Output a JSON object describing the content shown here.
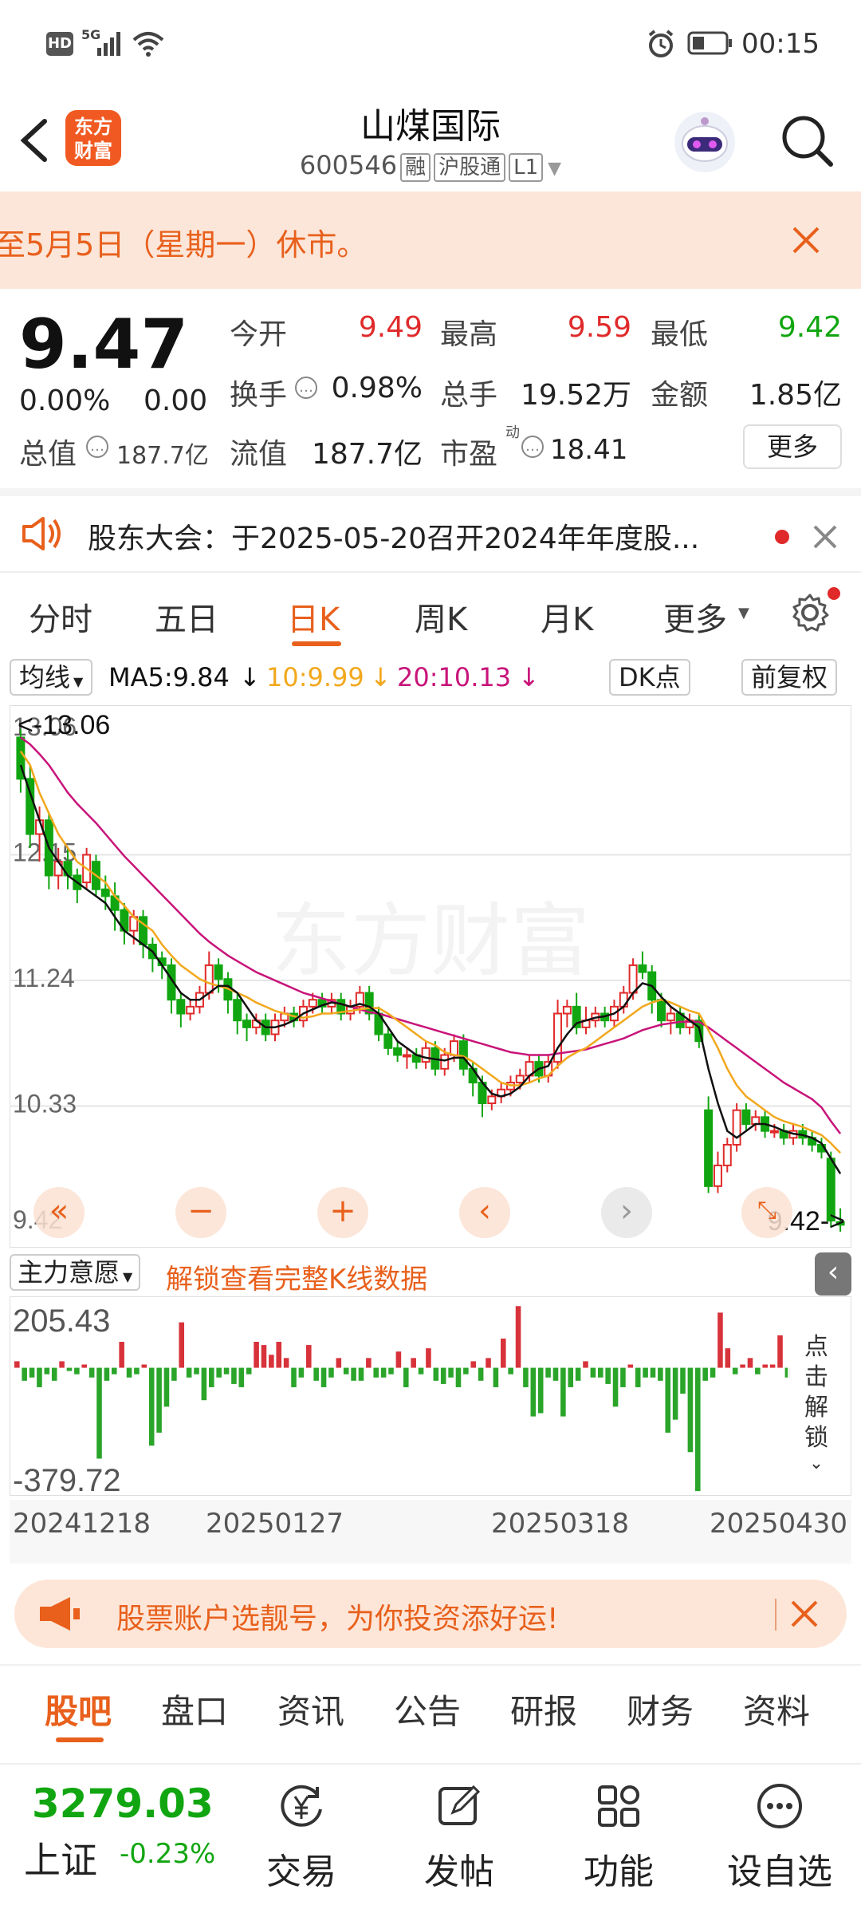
{
  "status_bar": {
    "left_badges": [
      "HD",
      "5G"
    ],
    "time": "00:15"
  },
  "header": {
    "logo_line1": "东方",
    "logo_line2": "财富",
    "title": "山煤国际",
    "code": "600546",
    "tags": [
      "融",
      "沪股通",
      "L1"
    ]
  },
  "notice": {
    "text": "至5月5日（星期一）休市。"
  },
  "quote": {
    "price": "9.47",
    "change_pct": "0.00%",
    "change_amt": "0.00",
    "fields": [
      {
        "label": "今开",
        "value": "9.49",
        "color": "#e02a2a"
      },
      {
        "label": "最高",
        "value": "9.59",
        "color": "#e02a2a"
      },
      {
        "label": "最低",
        "value": "9.42",
        "color": "#11a611"
      },
      {
        "label": "换手",
        "value": "0.98%",
        "color": "#222222"
      },
      {
        "label": "总手",
        "value": "19.52万",
        "color": "#222222"
      },
      {
        "label": "金额",
        "value": "1.85亿",
        "color": "#222222"
      }
    ],
    "market_cap_label": "总值",
    "market_cap": "187.7亿",
    "float_cap_label": "流值",
    "float_cap": "187.7亿",
    "pe_label": "市盈",
    "pe_sup": "动",
    "pe": "18.41",
    "more_label": "更多"
  },
  "announcement": {
    "text": "股东大会：于2025-05-20召开2024年年度股..."
  },
  "period_tabs": [
    "分时",
    "五日",
    "日K",
    "周K",
    "月K",
    "更多"
  ],
  "active_period": 2,
  "ma": {
    "selector": "均线",
    "ma5": "MA5:9.84",
    "ma10": "10:9.99",
    "ma20": "20:10.13",
    "dk_label": "DK点",
    "adjust_label": "前复权",
    "ma5_color": "#111111",
    "ma10_color": "#f2a81d",
    "ma20_color": "#c8147a"
  },
  "chart_data": [
    {
      "type": "candlestick",
      "y_ticks": [
        "13.06",
        "12.15",
        "11.24",
        "10.33",
        "9.42"
      ],
      "ylim": [
        9.42,
        13.06
      ],
      "max_marker": "<-13.06",
      "min_marker": "9.42->",
      "watermark": "东方财富",
      "candles": [
        [
          13.0,
          12.7,
          13.06,
          12.6
        ],
        [
          12.7,
          12.3,
          12.8,
          12.2
        ],
        [
          12.3,
          12.4,
          12.5,
          12.1
        ],
        [
          12.4,
          12.0,
          12.45,
          11.9
        ],
        [
          12.0,
          12.1,
          12.2,
          11.9
        ],
        [
          12.1,
          12.0,
          12.2,
          11.9
        ],
        [
          12.0,
          11.9,
          12.05,
          11.8
        ],
        [
          11.95,
          12.15,
          12.2,
          11.9
        ],
        [
          12.1,
          11.9,
          12.15,
          11.85
        ],
        [
          11.9,
          11.85,
          12.0,
          11.75
        ],
        [
          11.85,
          11.75,
          11.95,
          11.6
        ],
        [
          11.75,
          11.6,
          11.8,
          11.5
        ],
        [
          11.6,
          11.7,
          11.75,
          11.5
        ],
        [
          11.7,
          11.5,
          11.75,
          11.4
        ],
        [
          11.5,
          11.4,
          11.55,
          11.3
        ],
        [
          11.4,
          11.35,
          11.45,
          11.25
        ],
        [
          11.35,
          11.1,
          11.4,
          11.0
        ],
        [
          11.1,
          11.0,
          11.15,
          10.9
        ],
        [
          11.0,
          11.05,
          11.1,
          10.95
        ],
        [
          11.05,
          11.15,
          11.2,
          11.0
        ],
        [
          11.15,
          11.35,
          11.45,
          11.1
        ],
        [
          11.35,
          11.25,
          11.4,
          11.15
        ],
        [
          11.25,
          11.1,
          11.3,
          11.0
        ],
        [
          11.1,
          10.95,
          11.15,
          10.85
        ],
        [
          10.95,
          10.9,
          11.0,
          10.8
        ],
        [
          10.9,
          10.95,
          11.0,
          10.85
        ],
        [
          10.95,
          10.85,
          11.0,
          10.8
        ],
        [
          10.85,
          10.95,
          11.0,
          10.8
        ],
        [
          10.95,
          11.0,
          11.05,
          10.9
        ],
        [
          11.0,
          10.95,
          11.05,
          10.9
        ],
        [
          10.95,
          11.05,
          11.1,
          10.9
        ],
        [
          11.05,
          11.1,
          11.15,
          11.0
        ],
        [
          11.1,
          11.05,
          11.15,
          11.0
        ],
        [
          11.05,
          11.1,
          11.15,
          11.0
        ],
        [
          11.1,
          11.0,
          11.15,
          10.95
        ],
        [
          11.0,
          11.05,
          11.1,
          10.95
        ],
        [
          11.05,
          11.15,
          11.2,
          11.0
        ],
        [
          11.15,
          11.0,
          11.2,
          10.95
        ],
        [
          11.0,
          10.85,
          11.05,
          10.8
        ],
        [
          10.85,
          10.75,
          10.9,
          10.7
        ],
        [
          10.75,
          10.7,
          10.8,
          10.65
        ],
        [
          10.7,
          10.7,
          10.75,
          10.6
        ],
        [
          10.7,
          10.65,
          10.75,
          10.6
        ],
        [
          10.65,
          10.75,
          10.8,
          10.6
        ],
        [
          10.75,
          10.6,
          10.8,
          10.55
        ],
        [
          10.6,
          10.7,
          10.75,
          10.55
        ],
        [
          10.7,
          10.8,
          10.85,
          10.65
        ],
        [
          10.8,
          10.6,
          10.85,
          10.55
        ],
        [
          10.6,
          10.5,
          10.65,
          10.4
        ],
        [
          10.5,
          10.35,
          10.55,
          10.25
        ],
        [
          10.35,
          10.4,
          10.45,
          10.3
        ],
        [
          10.4,
          10.45,
          10.5,
          10.35
        ],
        [
          10.45,
          10.5,
          10.55,
          10.4
        ],
        [
          10.5,
          10.55,
          10.6,
          10.45
        ],
        [
          10.55,
          10.65,
          10.7,
          10.5
        ],
        [
          10.65,
          10.55,
          10.7,
          10.5
        ],
        [
          10.55,
          10.65,
          10.7,
          10.5
        ],
        [
          10.65,
          11.0,
          11.1,
          10.6
        ],
        [
          11.0,
          11.05,
          11.1,
          10.9
        ],
        [
          11.05,
          10.9,
          11.15,
          10.85
        ],
        [
          10.9,
          10.95,
          11.05,
          10.85
        ],
        [
          10.95,
          11.0,
          11.05,
          10.9
        ],
        [
          11.0,
          10.95,
          11.05,
          10.9
        ],
        [
          10.95,
          11.05,
          11.1,
          10.9
        ],
        [
          11.05,
          11.15,
          11.2,
          11.0
        ],
        [
          11.15,
          11.35,
          11.4,
          11.1
        ],
        [
          11.35,
          11.3,
          11.45,
          11.25
        ],
        [
          11.3,
          11.1,
          11.35,
          11.0
        ],
        [
          11.1,
          10.95,
          11.15,
          10.9
        ],
        [
          10.95,
          11.0,
          11.05,
          10.85
        ],
        [
          11.0,
          10.9,
          11.05,
          10.85
        ],
        [
          10.9,
          10.95,
          11.0,
          10.85
        ],
        [
          10.95,
          10.8,
          11.0,
          10.75
        ],
        [
          10.3,
          9.75,
          10.4,
          9.7
        ],
        [
          9.75,
          9.9,
          10.0,
          9.7
        ],
        [
          9.9,
          10.05,
          10.1,
          9.85
        ],
        [
          10.05,
          10.3,
          10.35,
          10.0
        ],
        [
          10.3,
          10.2,
          10.35,
          10.15
        ],
        [
          10.2,
          10.25,
          10.3,
          10.15
        ],
        [
          10.25,
          10.15,
          10.3,
          10.1
        ],
        [
          10.15,
          10.15,
          10.2,
          10.1
        ],
        [
          10.15,
          10.1,
          10.2,
          10.05
        ],
        [
          10.1,
          10.15,
          10.2,
          10.05
        ],
        [
          10.15,
          10.1,
          10.2,
          10.05
        ],
        [
          10.1,
          10.05,
          10.15,
          10.0
        ],
        [
          10.05,
          10.0,
          10.1,
          9.95
        ],
        [
          9.95,
          9.5,
          10.0,
          9.45
        ],
        [
          9.49,
          9.47,
          9.59,
          9.42
        ]
      ],
      "ma5": [
        12.8,
        12.6,
        12.4,
        12.2,
        12.1,
        12.0,
        11.95,
        11.9,
        11.85,
        11.8,
        11.7,
        11.6,
        11.55,
        11.5,
        11.45,
        11.35,
        11.25,
        11.15,
        11.1,
        11.1,
        11.15,
        11.2,
        11.2,
        11.15,
        11.05,
        10.95,
        10.9,
        10.9,
        10.92,
        10.95,
        11.0,
        11.03,
        11.06,
        11.08,
        11.07,
        11.05,
        11.07,
        11.05,
        11.0,
        10.9,
        10.8,
        10.75,
        10.7,
        10.68,
        10.67,
        10.66,
        10.68,
        10.68,
        10.6,
        10.5,
        10.42,
        10.4,
        10.42,
        10.47,
        10.55,
        10.6,
        10.62,
        10.75,
        10.85,
        10.93,
        10.95,
        10.97,
        10.98,
        11.0,
        11.05,
        11.15,
        11.22,
        11.2,
        11.12,
        11.05,
        11.0,
        10.95,
        10.9,
        10.6,
        10.35,
        10.15,
        10.1,
        10.15,
        10.2,
        10.2,
        10.18,
        10.15,
        10.13,
        10.12,
        10.1,
        10.06,
        9.95,
        9.84
      ],
      "ma10": [
        12.9,
        12.8,
        12.6,
        12.45,
        12.3,
        12.2,
        12.1,
        12.05,
        12.0,
        11.95,
        11.85,
        11.78,
        11.7,
        11.65,
        11.6,
        11.5,
        11.42,
        11.35,
        11.3,
        11.25,
        11.22,
        11.2,
        11.18,
        11.15,
        11.12,
        11.08,
        11.05,
        11.02,
        11.0,
        10.98,
        10.97,
        10.98,
        11.0,
        11.0,
        11.01,
        11.02,
        11.03,
        11.04,
        11.04,
        11.0,
        10.95,
        10.9,
        10.85,
        10.8,
        10.77,
        10.72,
        10.7,
        10.69,
        10.65,
        10.6,
        10.55,
        10.5,
        10.48,
        10.48,
        10.5,
        10.53,
        10.55,
        10.62,
        10.68,
        10.72,
        10.75,
        10.8,
        10.85,
        10.9,
        10.95,
        11.0,
        11.05,
        11.08,
        11.1,
        11.08,
        11.05,
        11.02,
        11.0,
        10.88,
        10.75,
        10.6,
        10.48,
        10.4,
        10.35,
        10.3,
        10.25,
        10.22,
        10.2,
        10.18,
        10.15,
        10.12,
        10.06,
        9.99
      ],
      "ma20": [
        13.0,
        12.95,
        12.88,
        12.8,
        12.7,
        12.6,
        12.52,
        12.45,
        12.38,
        12.3,
        12.22,
        12.14,
        12.07,
        12.0,
        11.93,
        11.86,
        11.79,
        11.72,
        11.65,
        11.58,
        11.52,
        11.47,
        11.42,
        11.38,
        11.34,
        11.3,
        11.27,
        11.24,
        11.21,
        11.18,
        11.15,
        11.13,
        11.11,
        11.09,
        11.07,
        11.05,
        11.03,
        11.01,
        11.0,
        10.98,
        10.96,
        10.94,
        10.92,
        10.9,
        10.88,
        10.86,
        10.84,
        10.82,
        10.8,
        10.78,
        10.76,
        10.74,
        10.72,
        10.71,
        10.7,
        10.7,
        10.7,
        10.71,
        10.72,
        10.73,
        10.74,
        10.76,
        10.78,
        10.8,
        10.82,
        10.85,
        10.88,
        10.9,
        10.92,
        10.93,
        10.94,
        10.94,
        10.94,
        10.9,
        10.85,
        10.8,
        10.75,
        10.7,
        10.65,
        10.6,
        10.55,
        10.5,
        10.46,
        10.42,
        10.38,
        10.32,
        10.22,
        10.13
      ]
    },
    {
      "type": "bar",
      "title": "主力意愿",
      "unlock_label": "解锁查看完整K线数据",
      "y_ticks": [
        "205.43",
        "-379.72"
      ],
      "ylim": [
        -379.72,
        205.43
      ],
      "x_ticks": [
        "20241218",
        "20250127",
        "20250318",
        "20250430"
      ],
      "values": [
        20,
        -40,
        -30,
        -60,
        -20,
        -40,
        20,
        -10,
        -20,
        10,
        -30,
        -280,
        -40,
        -20,
        80,
        -30,
        -20,
        10,
        -240,
        -200,
        -120,
        -40,
        140,
        -30,
        -20,
        -100,
        -60,
        -30,
        -20,
        -50,
        -60,
        -20,
        80,
        70,
        40,
        80,
        30,
        -60,
        -30,
        70,
        -40,
        -60,
        -30,
        30,
        -20,
        -40,
        -40,
        30,
        -30,
        -30,
        -20,
        50,
        -60,
        30,
        -20,
        60,
        -40,
        -50,
        -30,
        -60,
        -20,
        20,
        -40,
        30,
        -60,
        90,
        -20,
        190,
        -60,
        -150,
        -140,
        -30,
        -40,
        -150,
        -60,
        -40,
        20,
        -30,
        -30,
        -50,
        -120,
        -60,
        10,
        -60,
        -30,
        -30,
        -40,
        -200,
        -160,
        -80,
        -260,
        -380,
        -40,
        -30,
        170,
        60,
        -20,
        10,
        30,
        -20,
        10,
        10,
        100,
        -30
      ]
    }
  ],
  "chart_nav": {
    "unlock_side_label": "点击解锁"
  },
  "promo": {
    "text": "股票账户选靓号，为你投资添好运!"
  },
  "bottom_tabs": [
    "股吧",
    "盘口",
    "资讯",
    "公告",
    "研报",
    "财务",
    "资料"
  ],
  "footer": {
    "index_value": "3279.03",
    "index_name": "上证",
    "index_change": "-0.23%",
    "buttons": [
      "交易",
      "发帖",
      "功能",
      "设自选"
    ]
  }
}
